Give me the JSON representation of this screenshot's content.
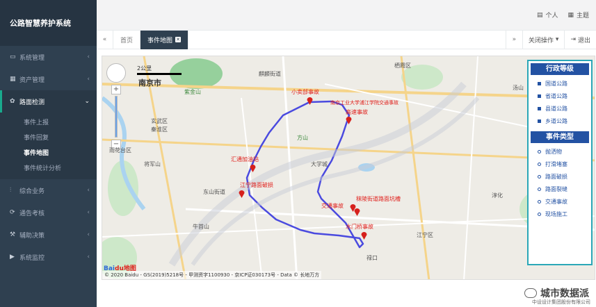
{
  "brand": "公路智慧养护系统",
  "sidebar": {
    "items": [
      {
        "label": "系统管理",
        "icon": "monitor-icon"
      },
      {
        "label": "资产管理",
        "icon": "cubes-icon"
      },
      {
        "label": "路面检测",
        "icon": "gear-icon"
      },
      {
        "label": "综合业务",
        "icon": "chart-icon"
      },
      {
        "label": "通告考核",
        "icon": "refresh-icon"
      },
      {
        "label": "辅助决策",
        "icon": "gavel-icon"
      },
      {
        "label": "系统监控",
        "icon": "video-icon"
      }
    ],
    "subitems": [
      "事件上报",
      "事件回复",
      "事件地图",
      "事件统计分析"
    ]
  },
  "header": {
    "personal": "个人",
    "theme": "主题"
  },
  "tabs": {
    "home": "首页",
    "active": "事件地图",
    "close_action": "关闭操作",
    "exit": "退出"
  },
  "map": {
    "city": "南京市",
    "labels": [
      "紫金山",
      "玄武区",
      "秦淮区",
      "雨花台区",
      "江宁区",
      "栖霞区",
      "麒麟街道",
      "方山",
      "大学城",
      "东山街道",
      "禄口",
      "淳化",
      "汤山",
      "牛首山",
      "将军山"
    ],
    "events": [
      "小卖部事故",
      "高速事故",
      "南京工业大学浦江学院交通事故",
      "汇通加油站",
      "江宁路面破损",
      "秣陵街道路面坑槽",
      "交通事故",
      "水门桥事故"
    ],
    "scale": "2公里",
    "copyright": "© 2020 Baidu - GS(2019)5218号 - 甲测资字1100930 - 京ICP证030173号 - Data © 长地万方",
    "logo_text": "Bai",
    "logo_suffix": "du地图"
  },
  "legend": {
    "admin_title": "行政等级",
    "admin_items": [
      "国道公路",
      "省道公路",
      "县道公路",
      "乡道公路"
    ],
    "event_title": "事件类型",
    "event_items": [
      "抛洒物",
      "打滑堵塞",
      "路面破损",
      "路面裂缝",
      "交通事故",
      "现场施工"
    ]
  },
  "watermark": "城市数据派",
  "company": "中设设计集团股份有限公司",
  "colors": {
    "sidebar": "#2f4050",
    "accent": "#19aa8d",
    "legend_header": "#2352a3",
    "route": "#4a4adf",
    "pin": "#d6201c"
  }
}
